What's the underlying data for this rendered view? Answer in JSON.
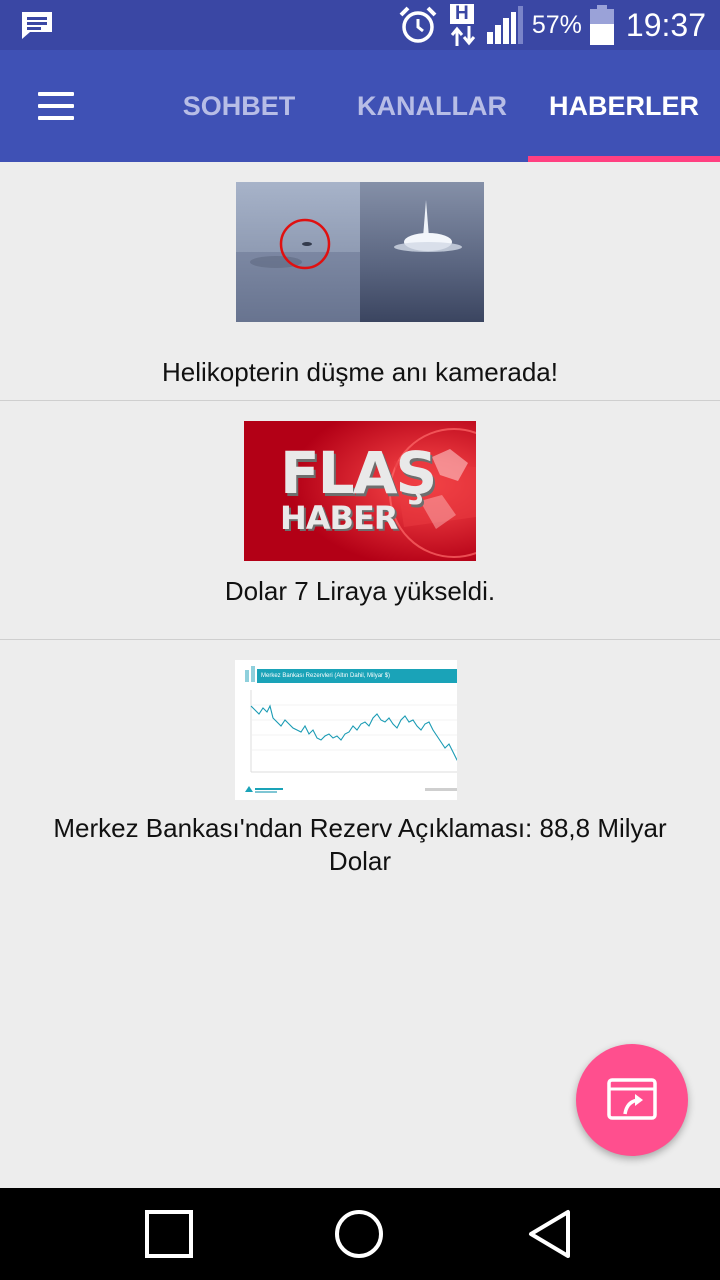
{
  "status_bar": {
    "notification_icon": "message-icon",
    "alarm_icon": "alarm-clock-icon",
    "network_type": "H",
    "signal_icon": "signal-bars-icon",
    "battery_percent": "57%",
    "battery_level": 0.57,
    "time": "19:37"
  },
  "app_bar": {
    "menu_icon": "hamburger-menu-icon",
    "tabs": [
      {
        "label": "SOHBET",
        "active": false
      },
      {
        "label": "KANALLAR",
        "active": false
      },
      {
        "label": "HABERLER",
        "active": true
      }
    ]
  },
  "news": [
    {
      "title": "Helikopterin düşme anı kamerada!",
      "thumbnail": "helicopter-crash-photo"
    },
    {
      "title": "Dolar 7 Liraya yükseldi.",
      "thumbnail": "flash-news-graphic",
      "thumb_text": [
        "FLAŞ",
        "HABER"
      ]
    },
    {
      "title": "Merkez Bankası'ndan Rezerv Açıklaması: 88,8 Milyar Dolar",
      "thumbnail": "reserve-chart-image",
      "thumb_header": "Merkez Bankası Rezervleri (Altın Dahil, Milyar $)"
    }
  ],
  "fab": {
    "icon": "share-screen-icon"
  },
  "nav_bar": {
    "buttons": [
      "recent-apps-icon",
      "home-icon",
      "back-icon"
    ]
  },
  "colors": {
    "status_bar": "#3a47a4",
    "app_bar": "#3f51b5",
    "tab_indicator": "#ff4081",
    "fab": "#ff4f8e",
    "background": "#ededed"
  }
}
